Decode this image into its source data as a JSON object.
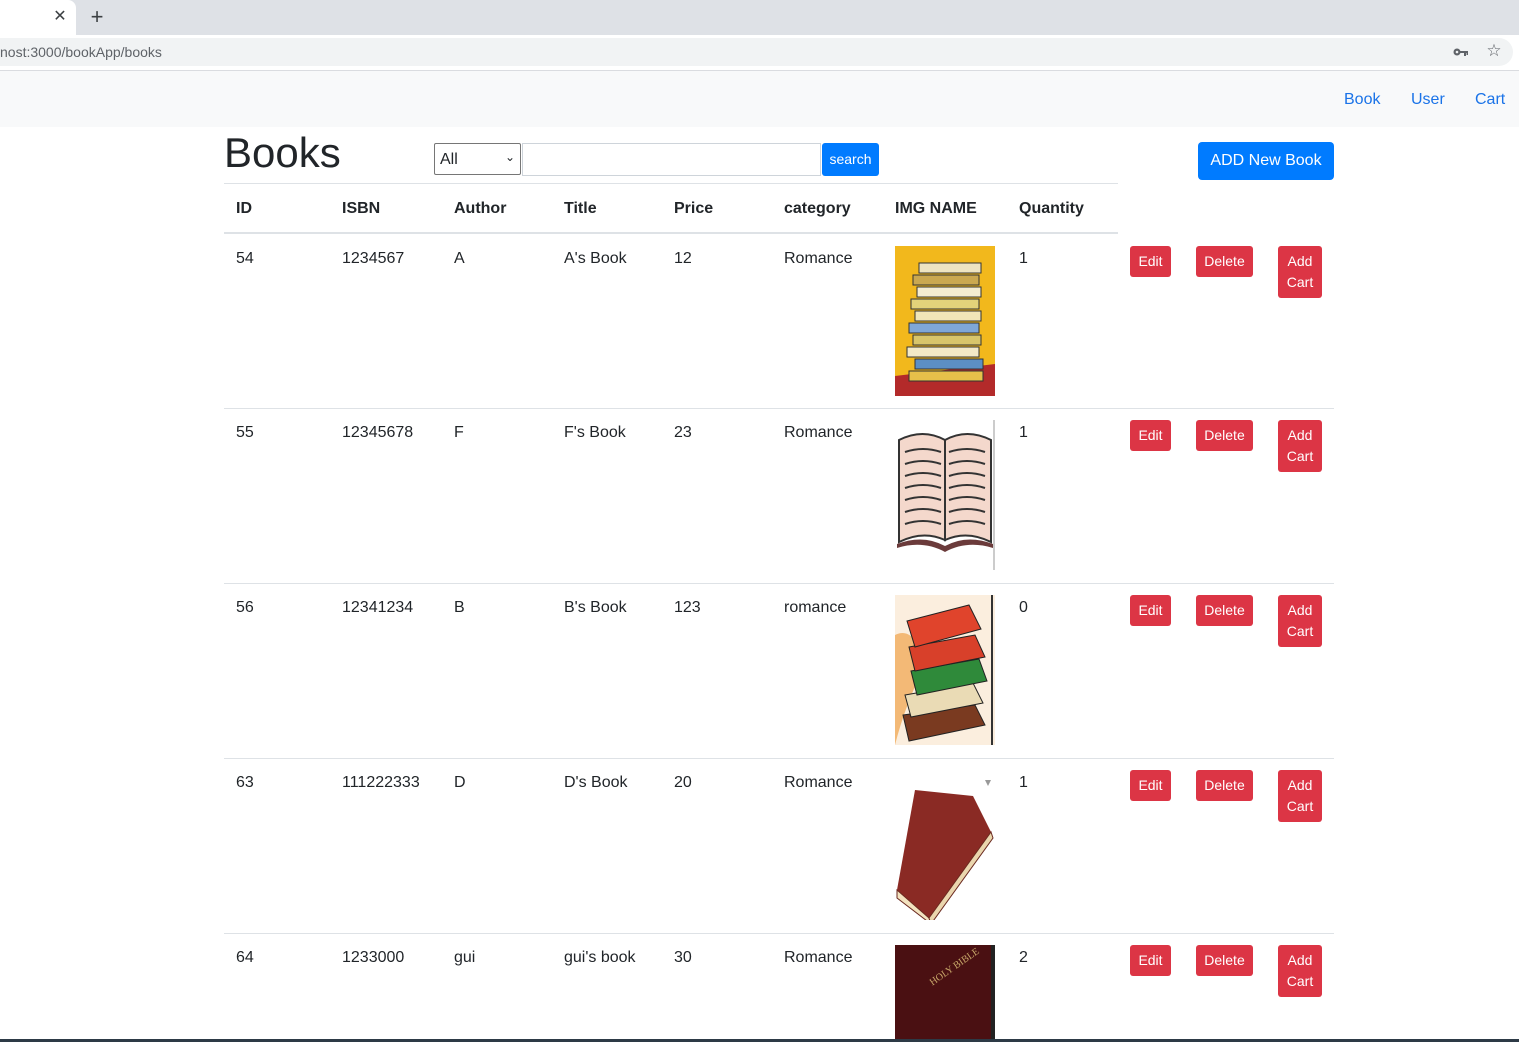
{
  "browser": {
    "tab_close": "✕",
    "new_tab": "+",
    "url": "nost:3000/bookApp/books"
  },
  "nav": {
    "book": "Book",
    "user": "User",
    "cart": "Cart"
  },
  "page": {
    "title": "Books",
    "filter_value": "All",
    "search_label": "search",
    "add_label": "ADD New Book"
  },
  "table": {
    "headers": [
      "ID",
      "ISBN",
      "Author",
      "Title",
      "Price",
      "category",
      "IMG NAME",
      "Quantity"
    ],
    "rows": [
      {
        "id": "54",
        "isbn": "1234567",
        "author": "A",
        "title": "A's Book",
        "price": "12",
        "category": "Romance",
        "quantity": "1",
        "image": "stack-of-books"
      },
      {
        "id": "55",
        "isbn": "12345678",
        "author": "F",
        "title": "F's Book",
        "price": "23",
        "category": "Romance",
        "quantity": "1",
        "image": "open-book"
      },
      {
        "id": "56",
        "isbn": "12341234",
        "author": "B",
        "title": "B's Book",
        "price": "123",
        "category": "romance",
        "quantity": "0",
        "image": "red-green-book-stack"
      },
      {
        "id": "63",
        "isbn": "111222333",
        "author": "D",
        "title": "D's Book",
        "price": "20",
        "category": "Romance",
        "quantity": "1",
        "image": "red-book"
      },
      {
        "id": "64",
        "isbn": "1233000",
        "author": "gui",
        "title": "gui's book",
        "price": "30",
        "category": "Romance",
        "quantity": "2",
        "image": "holy-bible"
      }
    ],
    "actions": {
      "edit": "Edit",
      "delete": "Delete",
      "cart_line1": "Add",
      "cart_line2": "Cart"
    }
  },
  "book_image_text": "HOLY BIBLE"
}
